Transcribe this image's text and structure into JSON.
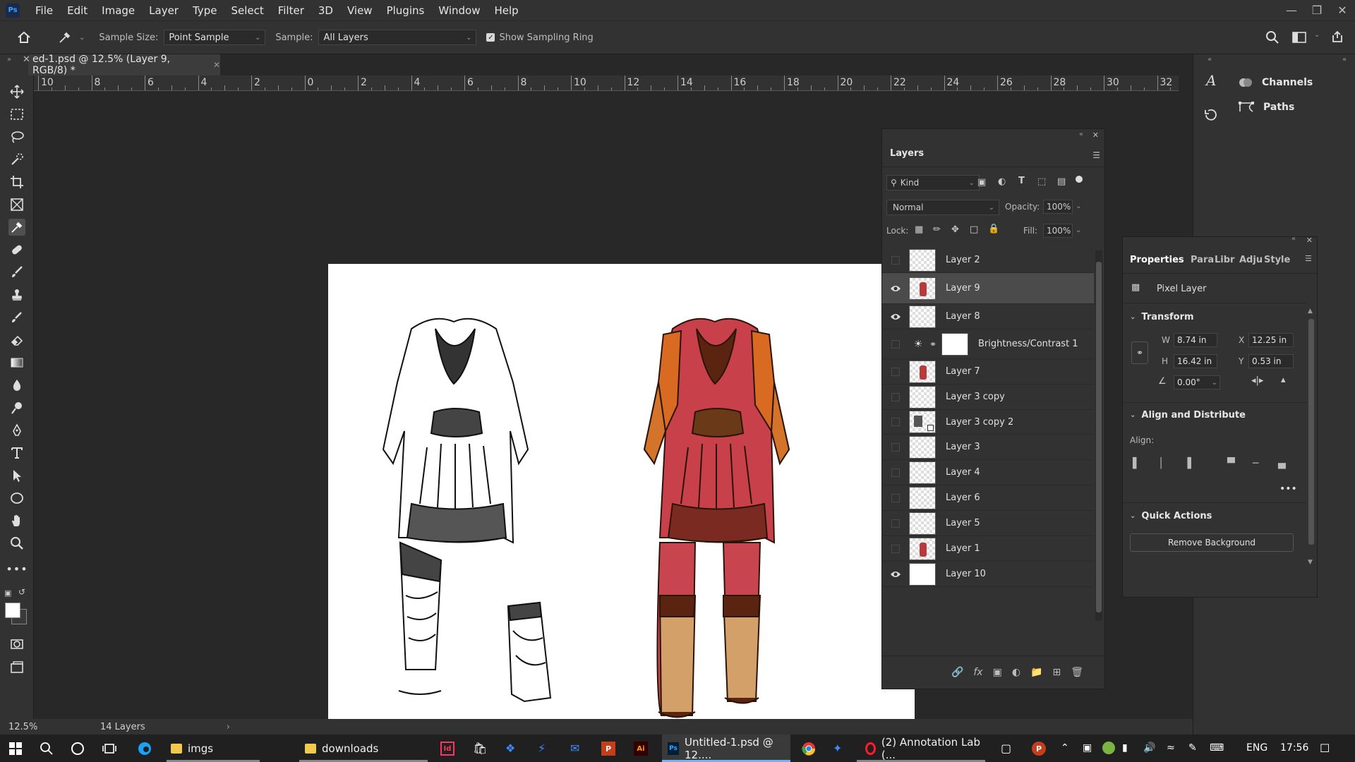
{
  "app": {
    "logo": "Ps"
  },
  "menu": [
    "File",
    "Edit",
    "Image",
    "Layer",
    "Type",
    "Select",
    "Filter",
    "3D",
    "View",
    "Plugins",
    "Window",
    "Help"
  ],
  "options_bar": {
    "sample_size_label": "Sample Size:",
    "sample_size_value": "Point Sample",
    "sample_label": "Sample:",
    "sample_value": "All Layers",
    "show_ring_label": "Show Sampling Ring",
    "show_ring_checked": true
  },
  "document_tab": {
    "title": "ed-1.psd @ 12.5% (Layer 9, RGB/8) *"
  },
  "ruler": {
    "labels": [
      "10",
      "8",
      "6",
      "4",
      "2",
      "0",
      "2",
      "4",
      "6",
      "8",
      "10",
      "12",
      "14",
      "16",
      "18",
      "20",
      "22",
      "24",
      "26",
      "28",
      "30",
      "32"
    ]
  },
  "status": {
    "zoom": "12.5%",
    "layers_count": "14 Layers"
  },
  "right_dock": {
    "channels_label": "Channels",
    "paths_label": "Paths"
  },
  "layers_panel": {
    "title": "Layers",
    "filter_kind": "Kind",
    "blend_mode": "Normal",
    "opacity_label": "Opacity:",
    "opacity_value": "100%",
    "lock_label": "Lock:",
    "fill_label": "Fill:",
    "fill_value": "100%",
    "layers": [
      {
        "name": "Layer 2",
        "visible": false,
        "thumb": "checker"
      },
      {
        "name": "Layer 9",
        "visible": true,
        "thumb": "figure",
        "selected": true
      },
      {
        "name": "Layer 8",
        "visible": true,
        "thumb": "checker"
      },
      {
        "name": "Brightness/Contrast 1",
        "visible": false,
        "thumb": "adjustment"
      },
      {
        "name": "Layer 7",
        "visible": false,
        "thumb": "figure"
      },
      {
        "name": "Layer 3 copy",
        "visible": false,
        "thumb": "checker"
      },
      {
        "name": "Layer 3 copy 2",
        "visible": false,
        "thumb": "smart"
      },
      {
        "name": "Layer 3",
        "visible": false,
        "thumb": "checker"
      },
      {
        "name": "Layer 4",
        "visible": false,
        "thumb": "checker"
      },
      {
        "name": "Layer 6",
        "visible": false,
        "thumb": "checker"
      },
      {
        "name": "Layer 5",
        "visible": false,
        "thumb": "checker"
      },
      {
        "name": "Layer 1",
        "visible": false,
        "thumb": "figure"
      },
      {
        "name": "Layer 10",
        "visible": true,
        "thumb": "white"
      }
    ]
  },
  "properties_panel": {
    "tabs": [
      "Properties",
      "Para",
      "Libr",
      "Adju",
      "Style"
    ],
    "layer_type": "Pixel Layer",
    "transform_title": "Transform",
    "w_label": "W",
    "w_value": "8.74 in",
    "h_label": "H",
    "h_value": "16.42 in",
    "x_label": "X",
    "x_value": "12.25 in",
    "y_label": "Y",
    "y_value": "0.53 in",
    "angle_value": "0.00°",
    "align_title": "Align and Distribute",
    "align_label": "Align:",
    "quick_title": "Quick Actions",
    "remove_bg_label": "Remove Background"
  },
  "taskbar": {
    "apps": [
      {
        "label": "imgs"
      },
      {
        "label": "downloads"
      },
      {
        "label": "Untitled-1.psd @ 12...."
      },
      {
        "label": "(2) Annotation Lab (..."
      }
    ],
    "lang": "ENG",
    "time": "17:56"
  },
  "colors": {
    "accent": "#31a8ff",
    "panel": "#323232",
    "bg": "#282828",
    "taskbar": "#202020"
  }
}
